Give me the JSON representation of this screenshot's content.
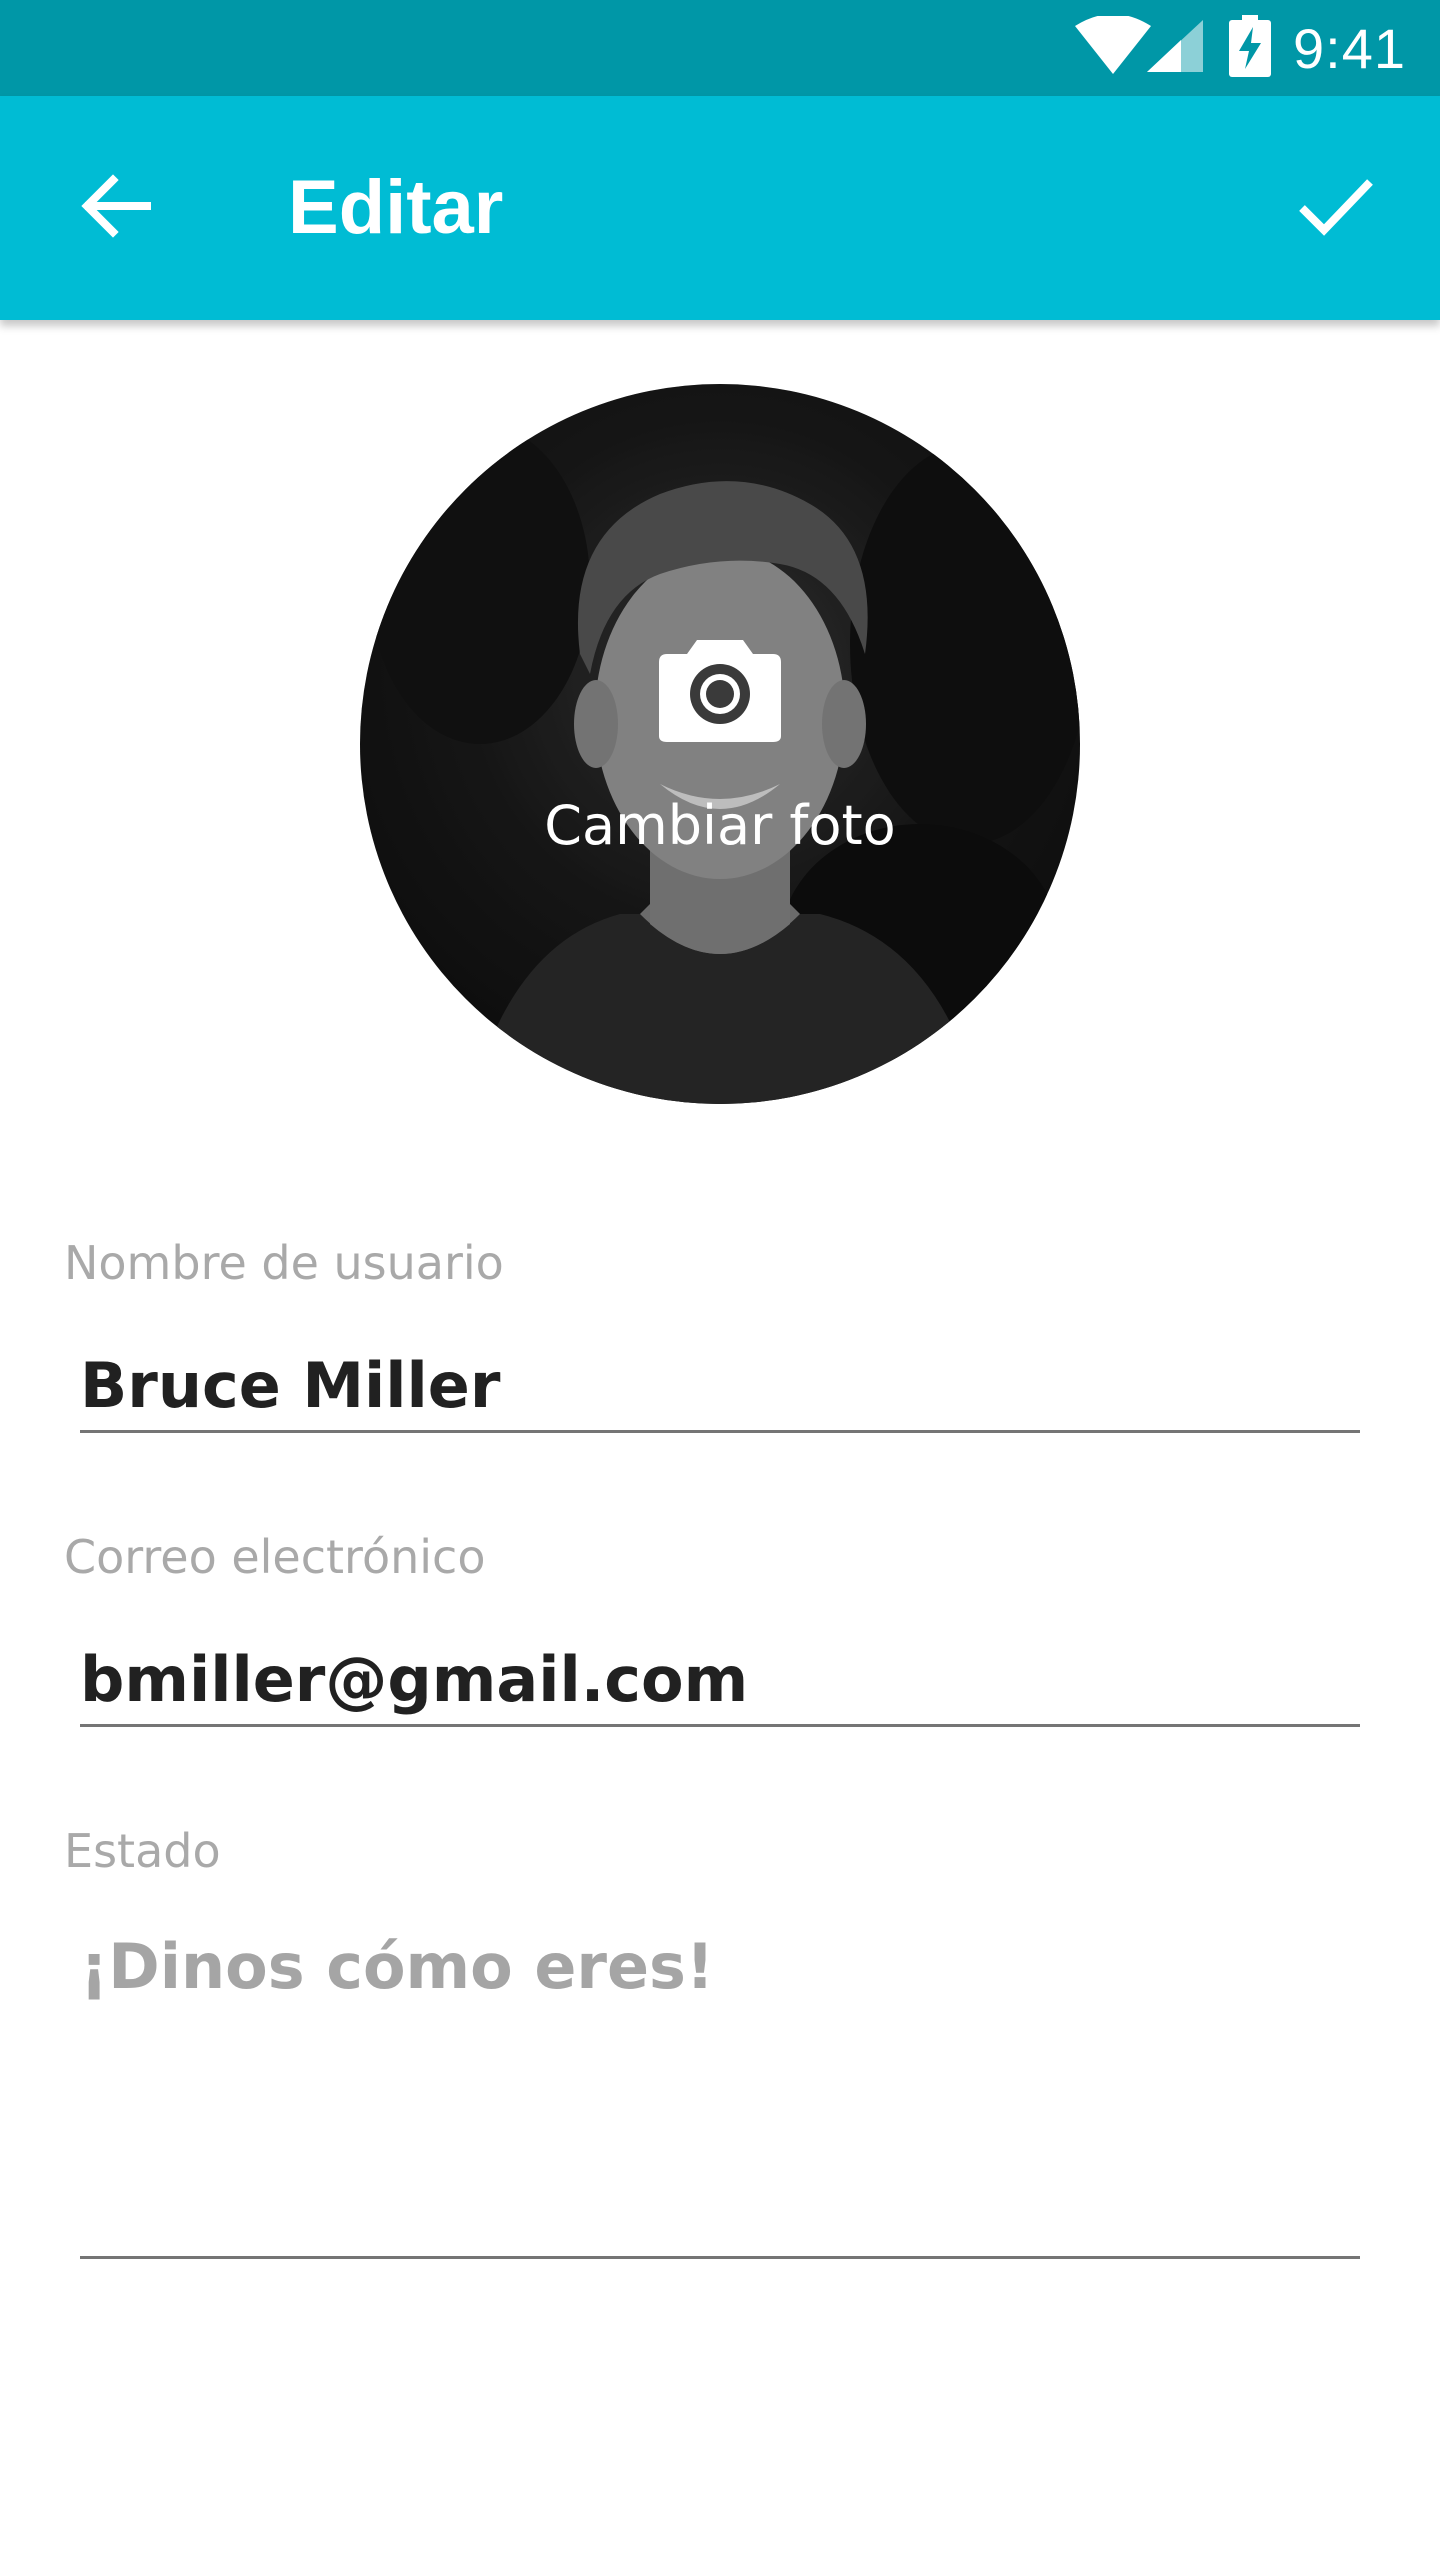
{
  "status_bar": {
    "time": "9:41",
    "icons": [
      "wifi-icon",
      "cellular-signal-icon",
      "battery-charging-icon"
    ],
    "color": "#0097a7"
  },
  "app_bar": {
    "title": "Editar",
    "back_icon": "arrow-back-icon",
    "confirm_icon": "check-icon",
    "color": "#00bcd4"
  },
  "avatar": {
    "change_photo_label": "Cambiar foto",
    "icon": "camera-icon"
  },
  "form": {
    "username": {
      "label": "Nombre de usuario",
      "value": "Bruce Miller"
    },
    "email": {
      "label": "Correo electrónico",
      "value": "bmiller@gmail.com"
    },
    "status": {
      "label": "Estado",
      "value": "",
      "placeholder": "¡Dinos cómo eres!"
    }
  }
}
